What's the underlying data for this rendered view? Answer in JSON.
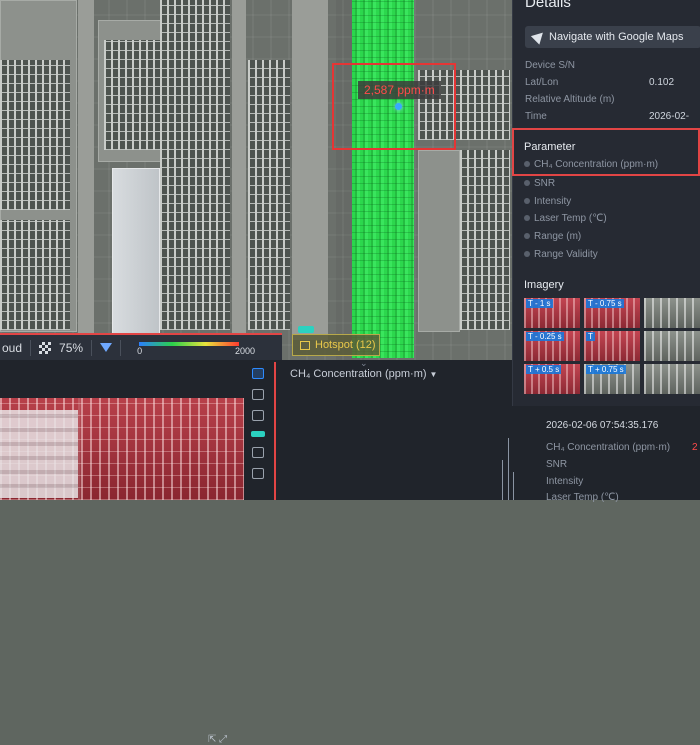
{
  "map": {
    "roi_label": "2,587 ppm·m",
    "toolbar": {
      "layer_label": "oud",
      "opacity": "75%",
      "scale_min": "0",
      "scale_max": "2000"
    },
    "hotspot": {
      "label": "Hotspot (12)"
    }
  },
  "bottom_panel": {
    "chart_selector": "CH₄ Concentration (ppm·m)"
  },
  "details": {
    "title": "Details",
    "navigate_button": "Navigate with Google Maps",
    "info": [
      {
        "label": "Device S/N",
        "value": ""
      },
      {
        "label": "Lat/Lon",
        "value": "0.102"
      },
      {
        "label": "Relative Altitude (m)",
        "value": ""
      },
      {
        "label": "Time",
        "value": "2026-02-"
      }
    ],
    "parameter": {
      "title": "Parameter",
      "rows": [
        "CH₄ Concentration (ppm·m)",
        "SNR",
        "Intensity",
        "Laser Temp (℃)",
        "Range (m)",
        "Range Validity"
      ]
    },
    "imagery": {
      "title": "Imagery",
      "thumbs": [
        "T - 1 s",
        "T - 0.75 s",
        "T - 0.25 s",
        "T",
        "T + 0.5 s",
        "T + 0.75 s"
      ]
    }
  },
  "record": {
    "time": "2026-02-06 07:54:35.176",
    "rows": [
      {
        "label": "CH₄ Concentration (ppm·m)",
        "value": "2"
      },
      {
        "label": "SNR",
        "value": ""
      },
      {
        "label": "Intensity",
        "value": ""
      },
      {
        "label": "Laser Temp (℃)",
        "value": ""
      }
    ]
  }
}
